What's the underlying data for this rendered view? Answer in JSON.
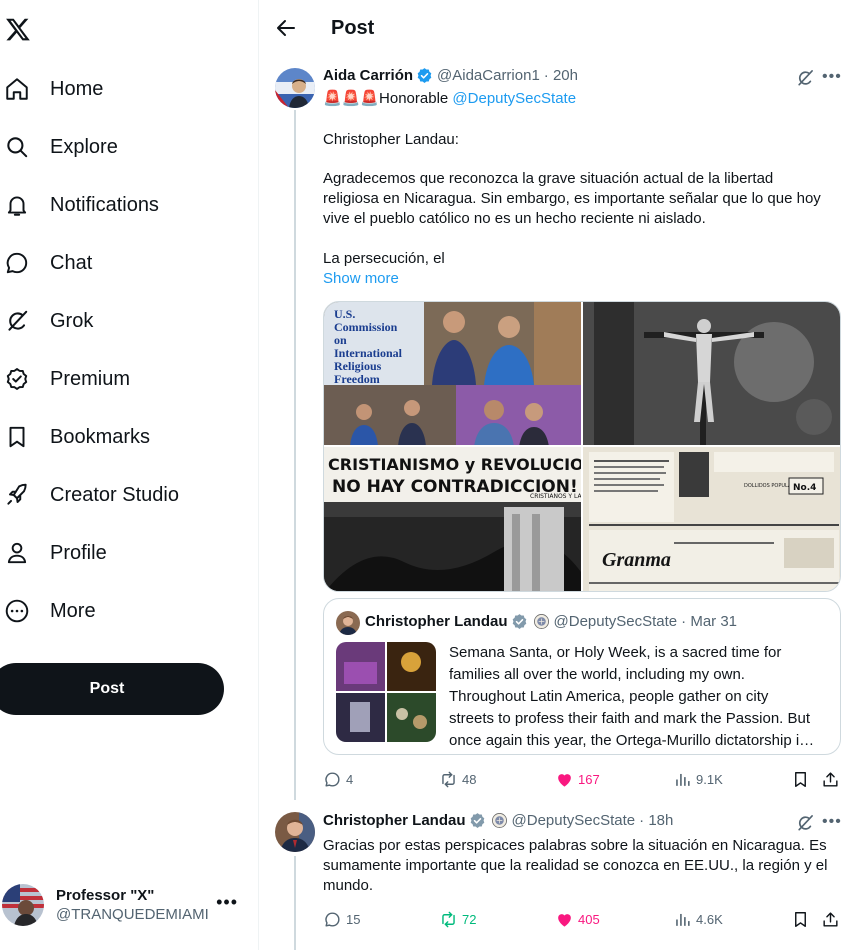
{
  "sidebar": {
    "logo_icon": "x-logo-icon",
    "items": [
      {
        "label": "Home",
        "icon": "home-icon"
      },
      {
        "label": "Explore",
        "icon": "search-icon"
      },
      {
        "label": "Notifications",
        "icon": "bell-icon"
      },
      {
        "label": "Chat",
        "icon": "chat-bubble-icon"
      },
      {
        "label": "Grok",
        "icon": "grok-icon"
      },
      {
        "label": "Premium",
        "icon": "premium-badge-icon"
      },
      {
        "label": "Bookmarks",
        "icon": "bookmark-icon"
      },
      {
        "label": "Creator Studio",
        "icon": "rocket-icon"
      },
      {
        "label": "Profile",
        "icon": "person-icon"
      },
      {
        "label": "More",
        "icon": "more-circle-icon"
      }
    ],
    "post_button": "Post",
    "account": {
      "name": "Professor \"X\"",
      "handle": "@TRANQUEDEMIAMI",
      "more": "•••"
    }
  },
  "header": {
    "title": "Post"
  },
  "main_post": {
    "author": "Aida Carrión",
    "handle": "@AidaCarrion1",
    "time": "· 20h",
    "line1_emoji": "🚨🚨🚨",
    "line1_text": "Honorable ",
    "line1_mention": "@DeputySecState",
    "para1": "Christopher Landau:",
    "para2": [
      "Agradecemos que reconozca la grave situación actual de la libertad",
      "religiosa en Nicaragua. Sin embargo, es importante señalar que lo que hoy",
      "vive el pueblo católico no es un hecho reciente ni aislado."
    ],
    "para3": "La persecución, el",
    "show_more": "Show more",
    "media": {
      "tl_sign": [
        "U.S.",
        "Commission",
        "on",
        "International",
        "Religious",
        "Freedom"
      ],
      "banner_top": "CRISTIANISMO y REVOLUCION",
      "banner_mid": "NO HAY CONTRADICCION!",
      "banner_small": "CRISTIANOS Y LA REVOLUCION",
      "stamp": "No.4",
      "doc_heading": "DOLLIDOS POPULARES",
      "newspaper": "Granma"
    },
    "quote": {
      "author": "Christopher Landau",
      "handle": "@DeputySecState",
      "date": "· Mar 31",
      "lines": [
        "Semana Santa, or Holy Week, is a sacred time for",
        "families all over the world, including my own.",
        "Throughout Latin America, people gather on city",
        "streets to profess their faith and mark the Passion. But",
        "once again this year, the Ortega-Murillo dictatorship i…"
      ]
    },
    "actions": {
      "replies": "4",
      "reposts": "48",
      "likes": "167",
      "views": "9.1K"
    }
  },
  "reply_post": {
    "author": "Christopher Landau",
    "handle": "@DeputySecState",
    "time": "· 18h",
    "lines": [
      "Gracias por estas perspicaces palabras sobre la situación en Nicaragua. Es",
      "sumamente importante que la realidad se conozca en EE.UU., la región y el",
      "mundo."
    ],
    "actions": {
      "replies": "15",
      "reposts": "72",
      "likes": "405",
      "views": "4.6K"
    }
  },
  "colors": {
    "accent": "#1d9bf0",
    "like": "#f91880",
    "repost_active": "#00ba7c",
    "muted": "#536471"
  }
}
